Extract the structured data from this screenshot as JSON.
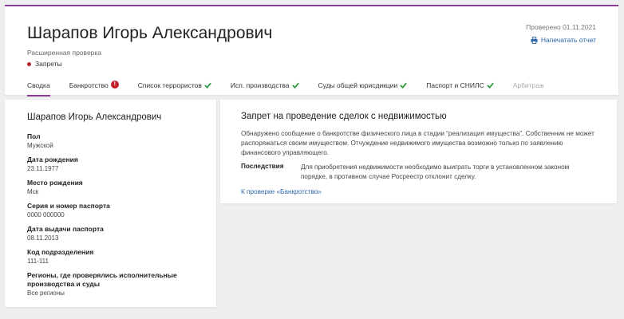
{
  "header": {
    "title": "Шарапов Игорь Александрович",
    "subtitle": "Расширенная проверка",
    "status": "Запреты",
    "checked_date": "Проверено 01.11.2021",
    "print_label": "Напечатать отчет",
    "colors": {
      "accent": "#8a3a92",
      "alert": "#c5202b",
      "ok": "#2e9b3f",
      "link": "#2b66a8"
    }
  },
  "tabs": [
    {
      "label": "Сводка",
      "state": "active"
    },
    {
      "label": "Банкротство",
      "state": "alert",
      "badge": "!"
    },
    {
      "label": "Список террористов",
      "state": "ok"
    },
    {
      "label": "Исп. производства",
      "state": "ok"
    },
    {
      "label": "Суды общей юрисдикции",
      "state": "ok"
    },
    {
      "label": "Паспорт и СНИЛС",
      "state": "ok"
    },
    {
      "label": "Арбитраж",
      "state": "disabled"
    }
  ],
  "person": {
    "name": "Шарапов Игорь Александрович",
    "fields": [
      {
        "label": "Пол",
        "value": "Мужской"
      },
      {
        "label": "Дата рождения",
        "value": "23.11.1977"
      },
      {
        "label": "Место рождения",
        "value": "Мск"
      },
      {
        "label": "Серия и номер паспорта",
        "value": "0000 000000"
      },
      {
        "label": "Дата выдачи паспорта",
        "value": "08.11.2013"
      },
      {
        "label": "Код подразделения",
        "value": "111-111"
      },
      {
        "label": "Регионы, где проверялись исполнительные производства и суды",
        "value": "Все регионы"
      }
    ]
  },
  "restriction": {
    "title": "Запрет на проведение сделок с недвижимостью",
    "description": "Обнаружено сообщение о банкротстве физического лица в стадии “реализация имущества”. Собственник не может распоряжаться своим имуществом. Отчуждение недвижимого имущества возможно только по заявлению финансового управляющего.",
    "consequences_label": "Последствия",
    "consequences_text": "Для приобретения недвижимости необходимо выиграть торги в установленном законом порядке, в противном случае Росреестр отклонит сделку.",
    "link_label": "К проверке «Банкротство»"
  }
}
